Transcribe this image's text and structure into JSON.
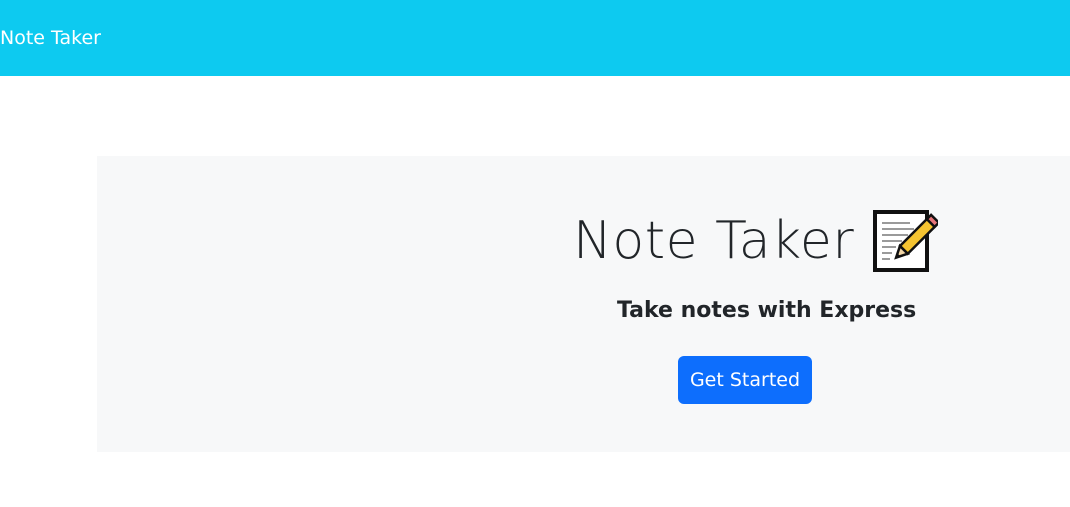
{
  "navbar": {
    "brand": "Note Taker",
    "background": "#0dcaf0"
  },
  "hero": {
    "title": "Note Taker",
    "title_icon": "memo-icon",
    "subtitle": "Take notes with Express",
    "cta_label": "Get Started",
    "background": "#f7f8f9"
  },
  "colors": {
    "primary": "#0d6efd",
    "info": "#0dcaf0"
  }
}
